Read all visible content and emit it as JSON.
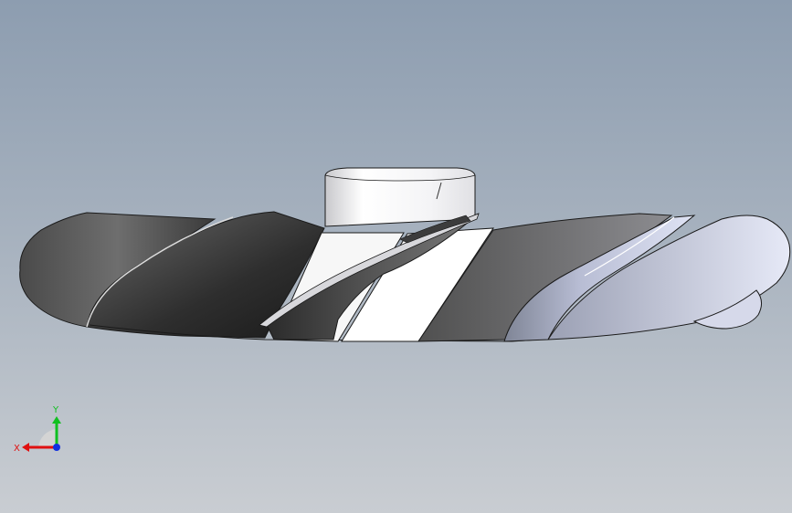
{
  "viewport": {
    "background_top": "#8d9db0",
    "background_bottom": "#c9cdd2"
  },
  "model": {
    "name": "impeller-model",
    "edge_color": "#1a1a1a"
  },
  "triad": {
    "x_label": "X",
    "y_label": "Y",
    "x_color": "#e01010",
    "y_color": "#10c020",
    "z_color": "#1030e0"
  }
}
